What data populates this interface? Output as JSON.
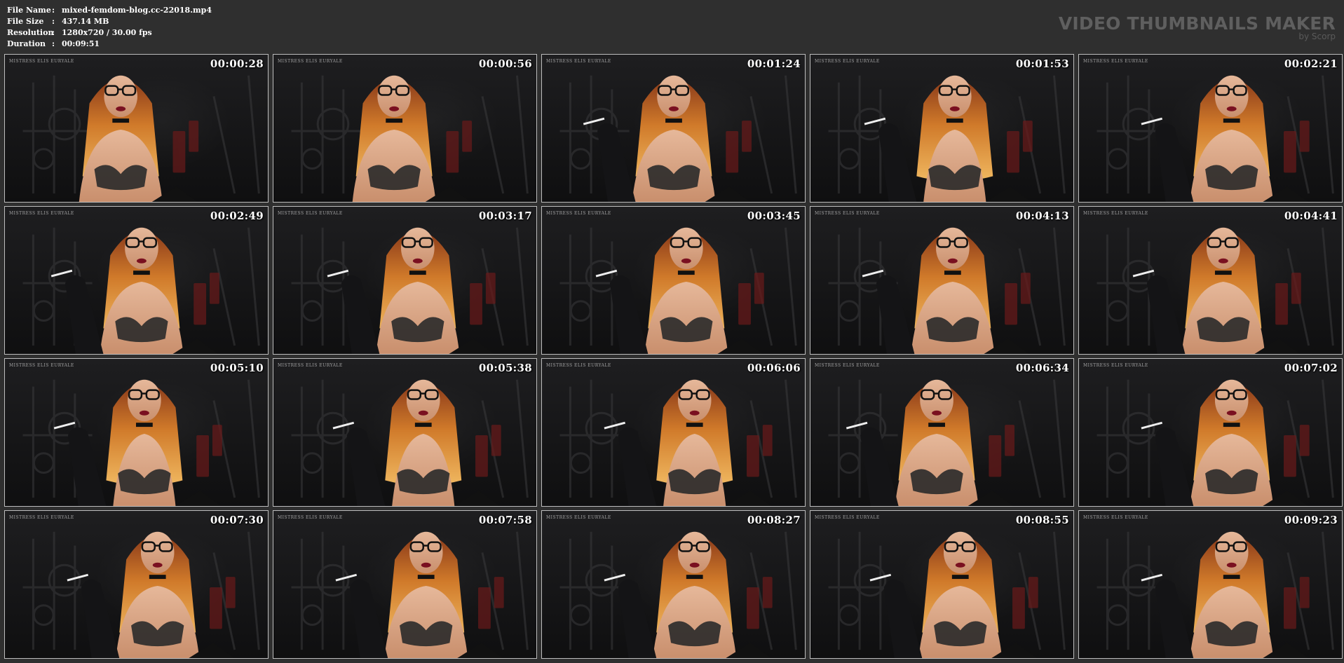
{
  "file_info": {
    "file_name_label": "File Name",
    "file_name_value": "mixed-femdom-blog.cc-22018.mp4",
    "file_size_label": "File Size",
    "file_size_value": "437.14 MB",
    "resolution_label": "Resolution",
    "resolution_value": "1280x720 / 30.00 fps",
    "duration_label": "Duration",
    "duration_value": "00:09:51",
    "separator": ":"
  },
  "brand": {
    "title": "VIDEO THUMBNAILS MAKER",
    "subtitle": "by Scorp"
  },
  "watermark_text": "MISTRESS ELIS EURYALE",
  "thumbnails": [
    {
      "time": "00:00:28",
      "x": 0.44,
      "hand": false,
      "wide": true
    },
    {
      "time": "00:00:56",
      "x": 0.46,
      "hand": false,
      "wide": true
    },
    {
      "time": "00:01:24",
      "x": 0.5,
      "hand": true,
      "wide": true
    },
    {
      "time": "00:01:53",
      "x": 0.55,
      "hand": true,
      "wide": false
    },
    {
      "time": "00:02:21",
      "x": 0.58,
      "hand": true,
      "wide": true
    },
    {
      "time": "00:02:49",
      "x": 0.52,
      "hand": true,
      "wide": true
    },
    {
      "time": "00:03:17",
      "x": 0.55,
      "hand": true,
      "wide": true
    },
    {
      "time": "00:03:45",
      "x": 0.55,
      "hand": true,
      "wide": true
    },
    {
      "time": "00:04:13",
      "x": 0.54,
      "hand": true,
      "wide": true
    },
    {
      "time": "00:04:41",
      "x": 0.55,
      "hand": true,
      "wide": true
    },
    {
      "time": "00:05:10",
      "x": 0.53,
      "hand": true,
      "wide": false
    },
    {
      "time": "00:05:38",
      "x": 0.57,
      "hand": true,
      "wide": false
    },
    {
      "time": "00:06:06",
      "x": 0.58,
      "hand": true,
      "wide": false
    },
    {
      "time": "00:06:34",
      "x": 0.48,
      "hand": true,
      "wide": true
    },
    {
      "time": "00:07:02",
      "x": 0.58,
      "hand": true,
      "wide": true
    },
    {
      "time": "00:07:30",
      "x": 0.58,
      "hand": true,
      "wide": true
    },
    {
      "time": "00:07:58",
      "x": 0.58,
      "hand": true,
      "wide": true
    },
    {
      "time": "00:08:27",
      "x": 0.58,
      "hand": true,
      "wide": true
    },
    {
      "time": "00:08:55",
      "x": 0.57,
      "hand": true,
      "wide": true
    },
    {
      "time": "00:09:23",
      "x": 0.58,
      "hand": true,
      "wide": true
    }
  ]
}
